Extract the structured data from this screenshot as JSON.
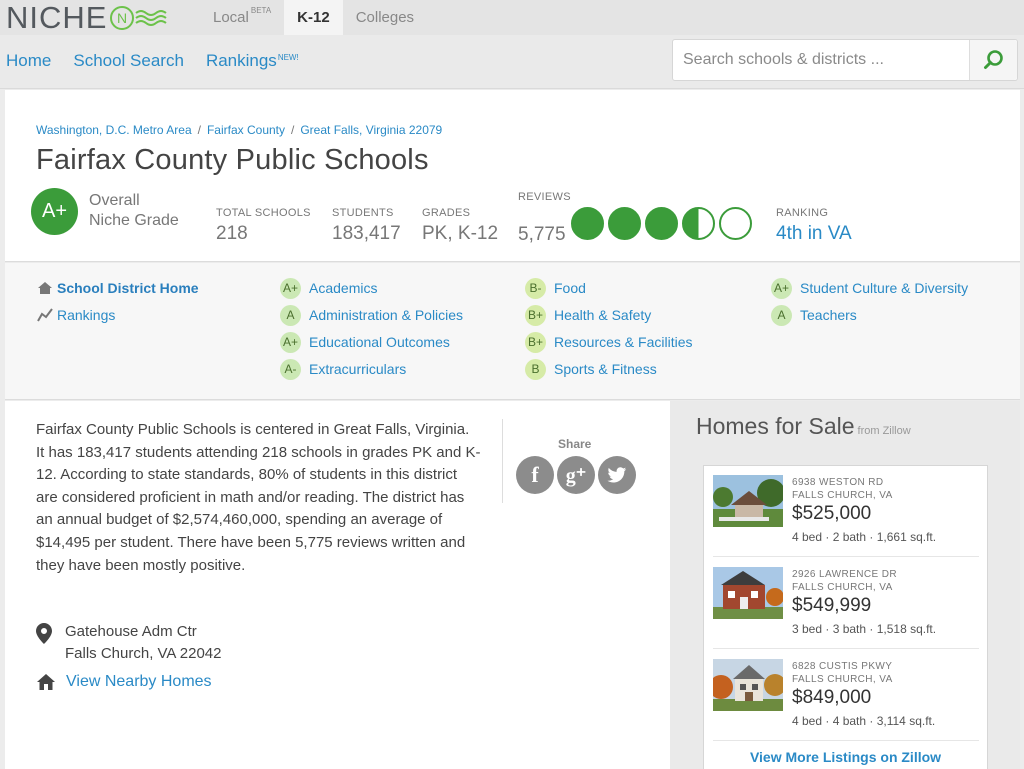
{
  "brand": {
    "logo_text": "NICHE",
    "accent": "#3b9c3a",
    "link_color": "#2a8ac6"
  },
  "top_tabs": [
    {
      "label": "Local",
      "badge": "BETA",
      "active": false
    },
    {
      "label": "K-12",
      "badge": "",
      "active": true
    },
    {
      "label": "Colleges",
      "badge": "",
      "active": false
    }
  ],
  "nav": {
    "home": "Home",
    "school_search": "School Search",
    "rankings": "Rankings",
    "rankings_badge": "NEW!"
  },
  "search": {
    "placeholder": "Search schools & districts ...",
    "icon": "search-icon"
  },
  "breadcrumb": [
    "Washington, D.C. Metro Area",
    "Fairfax County",
    "Great Falls",
    "Virginia 22079"
  ],
  "header": {
    "title": "Fairfax County Public Schools",
    "overall_grade": "A+",
    "overall_label_1": "Overall",
    "overall_label_2": "Niche Grade",
    "total_schools_label": "TOTAL SCHOOLS",
    "total_schools": "218",
    "students_label": "STUDENTS",
    "students": "183,417",
    "grades_label": "GRADES",
    "grades": "PK, K-12",
    "reviews_label": "REVIEWS",
    "reviews_count": "5,775",
    "review_rating": 3.5,
    "ranking_label": "RANKING",
    "ranking": "4th in VA"
  },
  "report_card": {
    "home": "School District Home",
    "rankings": "Rankings",
    "items": [
      {
        "grade": "A+",
        "label": "Academics"
      },
      {
        "grade": "A",
        "label": "Administration & Policies"
      },
      {
        "grade": "A+",
        "label": "Educational Outcomes"
      },
      {
        "grade": "A-",
        "label": "Extracurriculars"
      },
      {
        "grade": "B-",
        "label": "Food"
      },
      {
        "grade": "B+",
        "label": "Health & Safety"
      },
      {
        "grade": "B+",
        "label": "Resources & Facilities"
      },
      {
        "grade": "B",
        "label": "Sports & Fitness"
      },
      {
        "grade": "A+",
        "label": "Student Culture & Diversity"
      },
      {
        "grade": "A",
        "label": "Teachers"
      }
    ]
  },
  "description": "Fairfax County Public Schools is centered in Great Falls, Virginia. It has 183,417 students attending 218 schools in grades PK and K-12. According to state standards, 80% of students in this district are considered proficient in math and/or reading. The district has an annual budget of $2,574,460,000, spending an average of $14,495 per student. There have been 5,775 reviews written and they have been mostly positive.",
  "share": {
    "label": "Share",
    "facebook": "f",
    "google": "g⁺"
  },
  "address": {
    "line1": "Gatehouse Adm Ctr",
    "line2": "Falls Church, VA 22042"
  },
  "nearby_link": "View Nearby Homes",
  "homes": {
    "title": "Homes for Sale",
    "source": "from Zillow",
    "listings": [
      {
        "street": "6938 WESTON RD",
        "city": "FALLS CHURCH, VA",
        "price": "$525,000",
        "specs": "4 bed · 2 bath · 1,661 sq.ft."
      },
      {
        "street": "2926 LAWRENCE DR",
        "city": "FALLS CHURCH, VA",
        "price": "$549,999",
        "specs": "3 bed · 3 bath · 1,518 sq.ft."
      },
      {
        "street": "6828 CUSTIS PKWY",
        "city": "FALLS CHURCH, VA",
        "price": "$849,000",
        "specs": "4 bed · 4 bath · 3,114 sq.ft."
      }
    ],
    "more_link": "View More Listings on Zillow"
  }
}
